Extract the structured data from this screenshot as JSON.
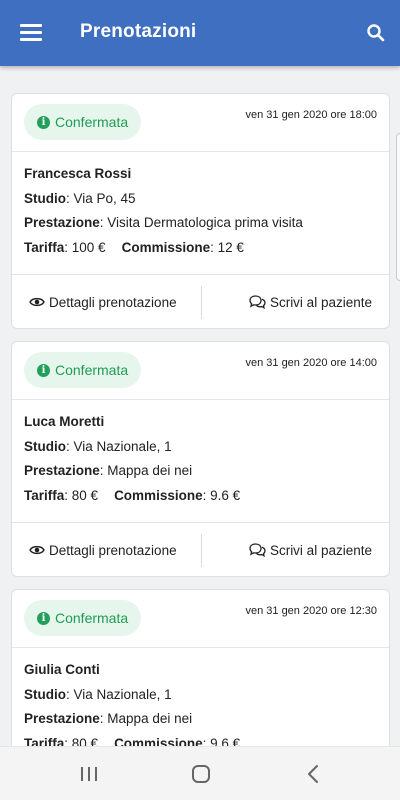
{
  "app": {
    "title": "Prenotazioni"
  },
  "colors": {
    "primary": "#3f6fc0",
    "status_confirmed": "#1f9d55",
    "status_confirmed_bg": "#e6f6ec"
  },
  "labels": {
    "studio": "Studio",
    "prestazione": "Prestazione",
    "tariffa": "Tariffa",
    "commissione": "Commissione",
    "details_button": "Dettagli prenotazione",
    "message_button": "Scrivi al paziente"
  },
  "bookings": [
    {
      "status": "Confermata",
      "datetime": "ven 31 gen 2020 ore 18:00",
      "patient": "Francesca Rossi",
      "studio": "Via Po, 45",
      "prestazione": "Visita Dermatologica prima visita",
      "tariffa": "100 €",
      "commissione": "12 €"
    },
    {
      "status": "Confermata",
      "datetime": "ven 31 gen 2020 ore 14:00",
      "patient": "Luca Moretti",
      "studio": "Via Nazionale, 1",
      "prestazione": "Mappa dei nei",
      "tariffa": "80 €",
      "commissione": "9.6 €"
    },
    {
      "status": "Confermata",
      "datetime": "ven 31 gen 2020 ore 12:30",
      "patient": "Giulia Conti",
      "studio": "Via Nazionale, 1",
      "prestazione": "Mappa dei nei",
      "tariffa": "80 €",
      "commissione": "9.6 €"
    }
  ],
  "icons": {
    "menu": "hamburger-menu-icon",
    "search": "search-icon",
    "status": "info-icon",
    "details": "eye-icon",
    "message": "chat-bubbles-icon",
    "nav_recents": "recents-icon",
    "nav_home": "home-icon",
    "nav_back": "back-icon"
  }
}
